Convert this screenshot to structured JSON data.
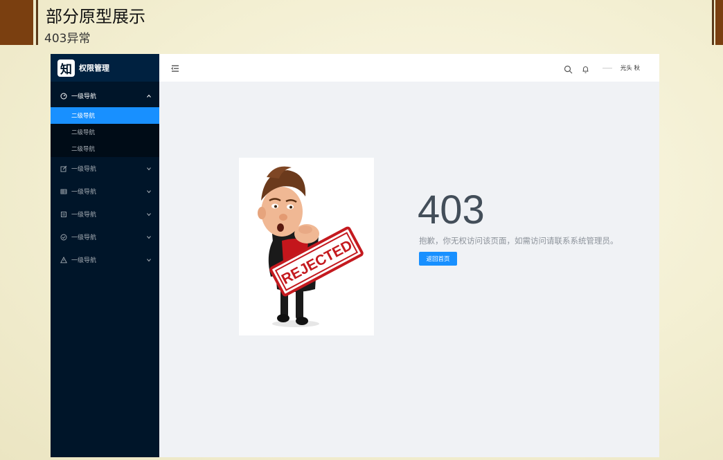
{
  "slide": {
    "title": "部分原型展示",
    "subtitle": "403异常"
  },
  "logo": {
    "glyph": "知",
    "text": "权限管理"
  },
  "sidebar": {
    "items": [
      {
        "label": "一级导航",
        "icon": "dashboard-icon",
        "open": true,
        "children": [
          {
            "label": "二级导航",
            "active": true
          },
          {
            "label": "二级导航",
            "active": false
          },
          {
            "label": "二级导航",
            "active": false
          }
        ]
      },
      {
        "label": "一级导航",
        "icon": "form-icon"
      },
      {
        "label": "一级导航",
        "icon": "table-icon"
      },
      {
        "label": "一级导航",
        "icon": "profile-icon"
      },
      {
        "label": "一级导航",
        "icon": "check-circle-icon"
      },
      {
        "label": "一级导航",
        "icon": "warning-icon"
      }
    ]
  },
  "header": {
    "user": "光头 秋"
  },
  "error": {
    "code": "403",
    "message": "抱歉，你无权访问该页面，如需访问请联系系统管理员。",
    "back_label": "返回首页",
    "stamp_text": "REJECTED"
  },
  "colors": {
    "sidebar": "#001529",
    "accent": "#1890ff",
    "content_bg": "#f0f2f5",
    "stamp": "#c41a1f"
  }
}
